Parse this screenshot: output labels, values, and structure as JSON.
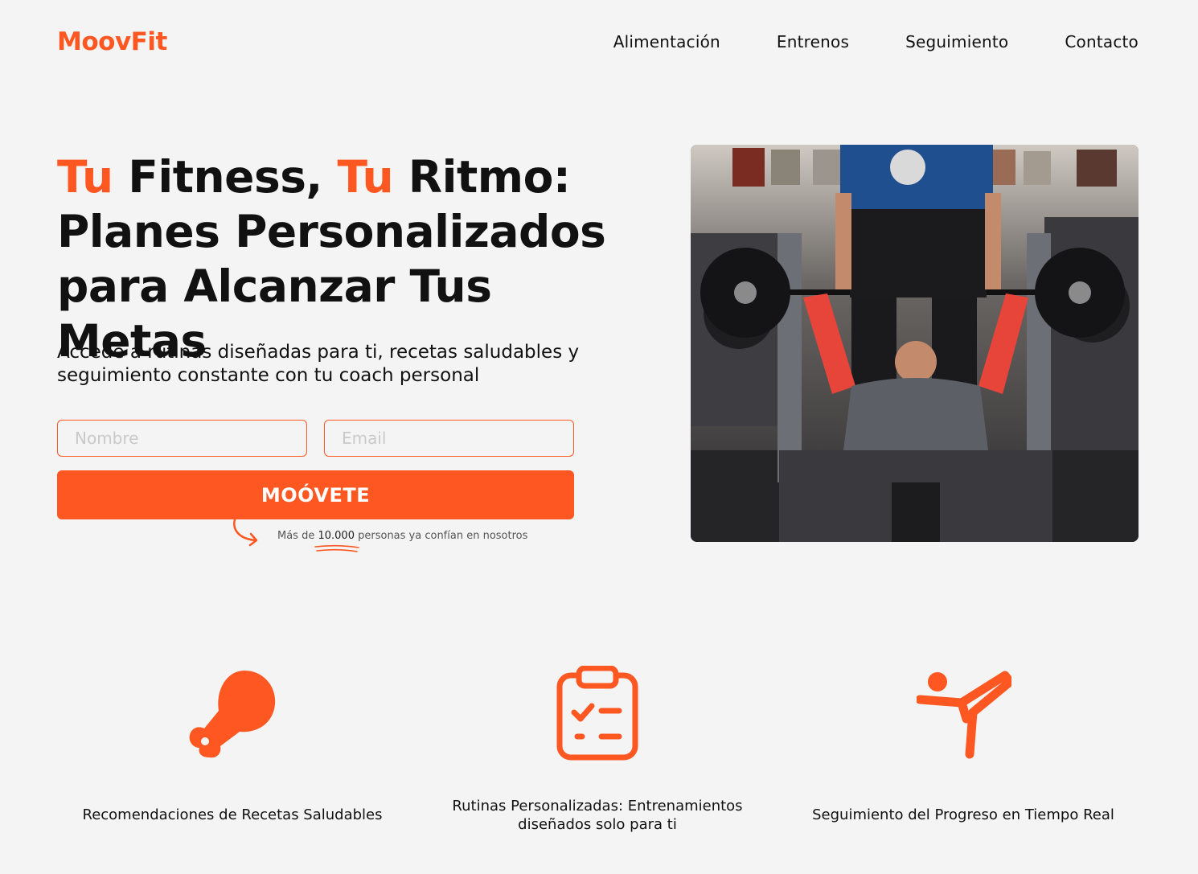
{
  "header": {
    "logo": "MoovFit",
    "nav": [
      "Alimentación",
      "Entrenos",
      "Seguimiento",
      "Contacto"
    ]
  },
  "hero": {
    "title_part1": "Tu",
    "title_part2": " Fitness, ",
    "title_part3": "Tu",
    "title_part4": " Ritmo:",
    "title_line2": "Planes Personalizados",
    "title_line3": "para Alcanzar Tus Metas",
    "subtitle": "Accede a rutinas diseñadas para ti, recetas saludables y seguimiento constante con tu coach personal",
    "form": {
      "name_placeholder": "Nombre",
      "email_placeholder": "Email",
      "name_value": "",
      "email_value": ""
    },
    "cta_label": "MOÓVETE",
    "trust_prefix": "Más de ",
    "trust_number": "10.000",
    "trust_suffix": " personas ya confían en nosotros"
  },
  "features": [
    {
      "icon": "chicken-leg-icon",
      "label": "Recomendaciones de Recetas Saludables"
    },
    {
      "icon": "clipboard-checklist-icon",
      "label": "Rutinas Personalizadas: Entrenamientos diseñados solo para ti"
    },
    {
      "icon": "martial-arts-kick-icon",
      "label": "Seguimiento del Progreso en Tiempo Real"
    }
  ],
  "colors": {
    "accent": "#fe5722",
    "background": "#f4f4f4",
    "text": "#111111"
  }
}
